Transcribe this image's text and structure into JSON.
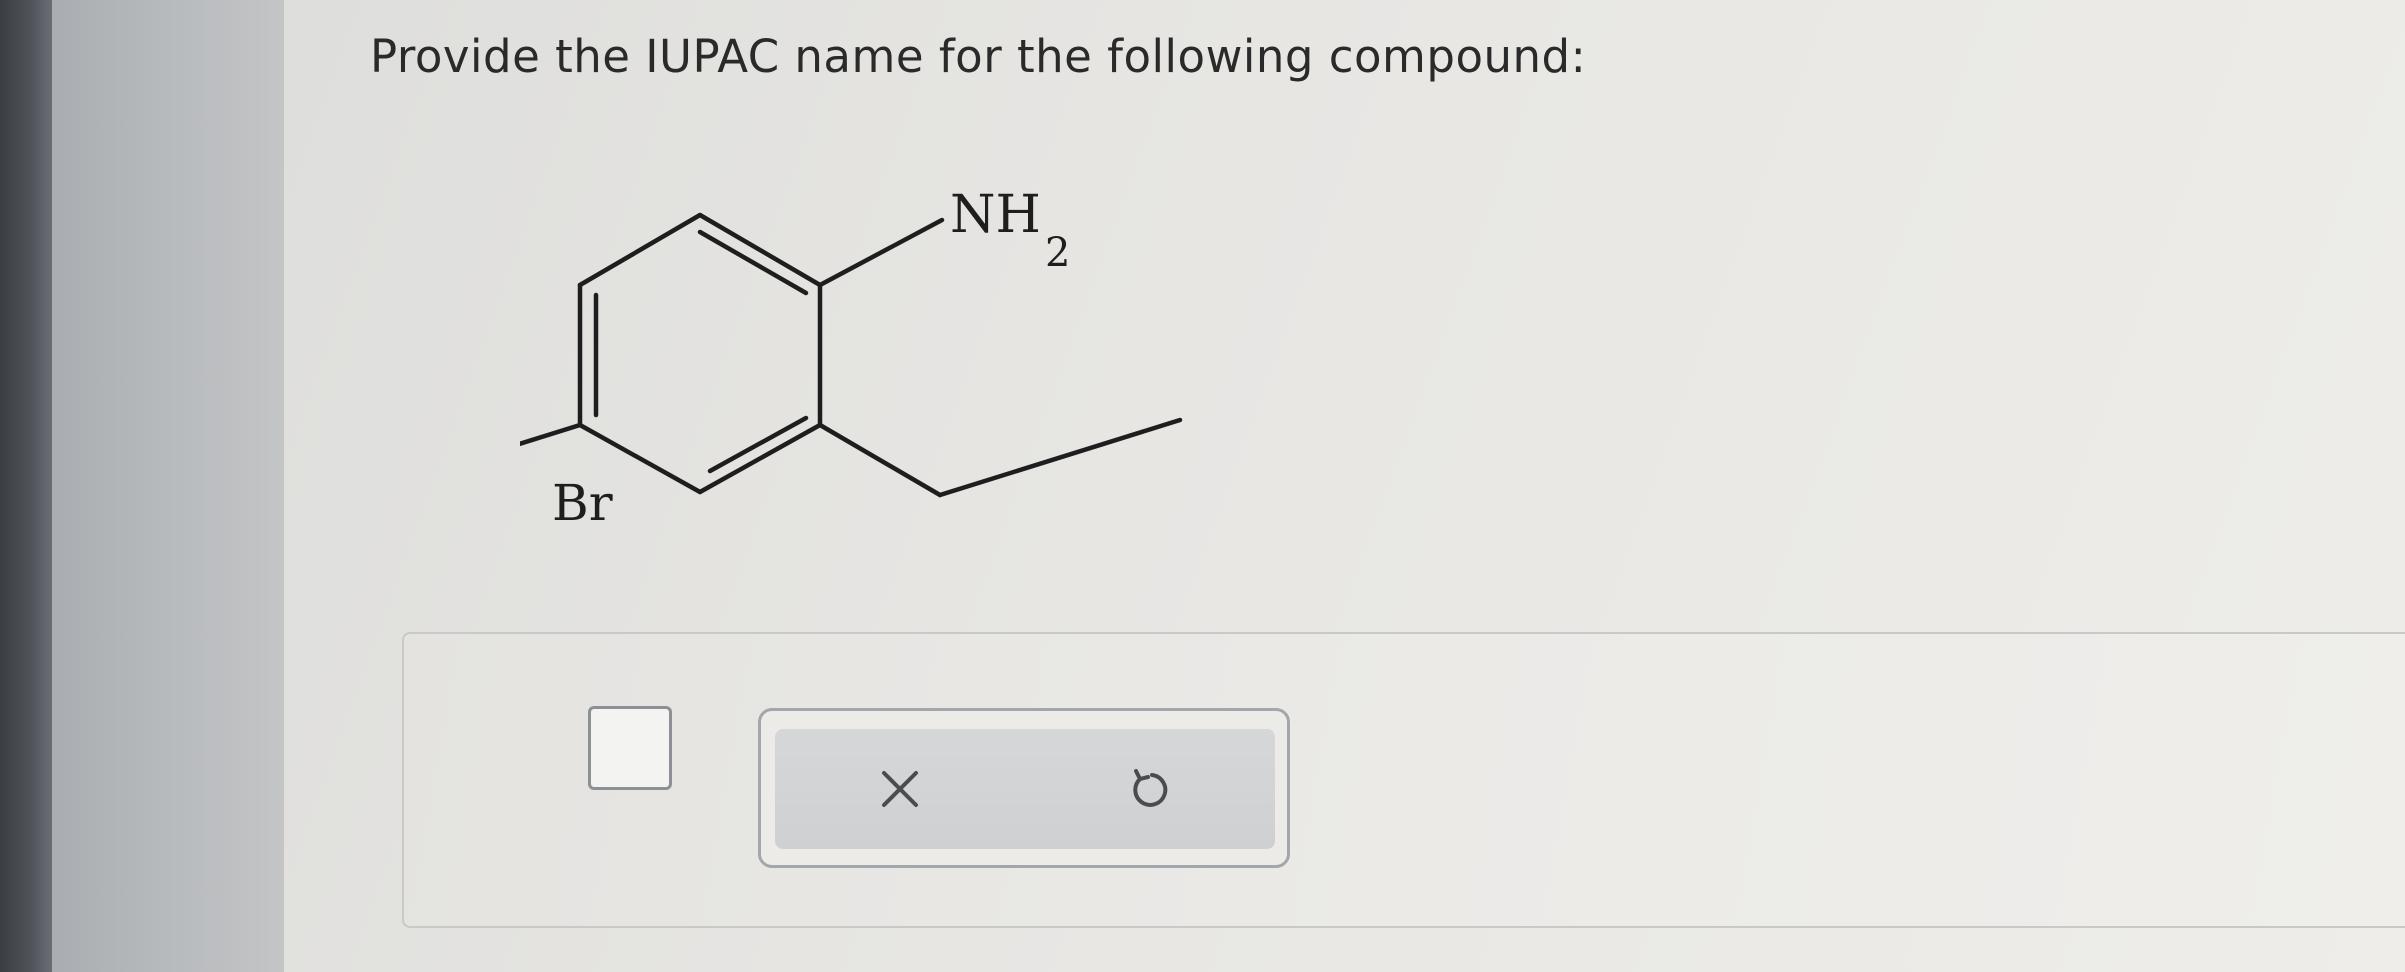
{
  "question": {
    "prompt": "Provide the IUPAC name for the following compound:"
  },
  "molecule": {
    "substituent_top": "NH",
    "substituent_top_subscript": "2",
    "substituent_left": "Br"
  },
  "answer": {
    "value": ""
  },
  "toolbar": {
    "clear_icon": "close-icon",
    "undo_icon": "undo-icon"
  },
  "colors": {
    "text": "#2a2a2a",
    "button_bg": "#d3d4d6",
    "border": "#a3a6aa"
  }
}
